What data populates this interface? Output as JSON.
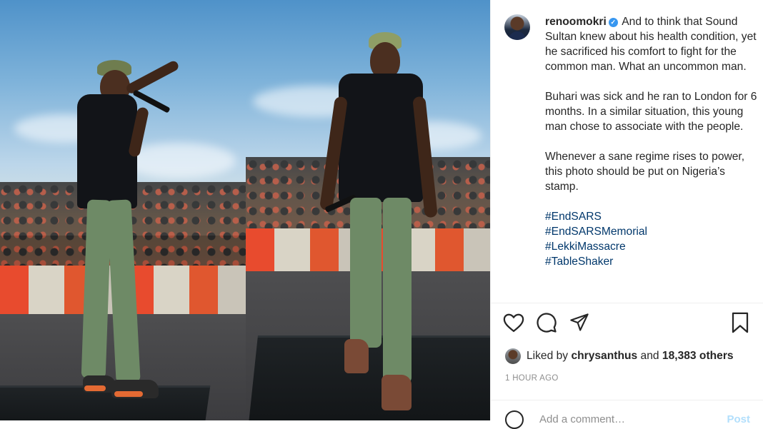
{
  "post": {
    "username": "renoomokri",
    "verified": true,
    "caption_paragraphs": [
      "And to think that Sound Sultan knew about his health condition, yet he sacrificed his comfort to fight for the common man. What an uncommon man.",
      "Buhari was sick and he ran to London for 6 months. In a similar situation, this young man chose to associate with the people.",
      "Whenever a sane regime rises to power, this photo should be put on Nigeria’s stamp."
    ],
    "hashtags": [
      "#EndSARS",
      "#EndSARSMemorial",
      "#LekkiMassacre",
      "#TableShaker"
    ]
  },
  "actions": {
    "icons": [
      "heart-icon",
      "comment-icon",
      "share-icon",
      "bookmark-icon"
    ]
  },
  "likes": {
    "prefix": "Liked by",
    "user": "chrysanthus",
    "conjunction": "and",
    "others": "18,383 others"
  },
  "timestamp": "1 HOUR AGO",
  "comment": {
    "placeholder": "Add a comment…",
    "post_label": "Post"
  },
  "colors": {
    "link": "#00376b",
    "verified": "#3897f0",
    "post_button_disabled": "#b2dffc",
    "muted": "#8e8e8e"
  }
}
